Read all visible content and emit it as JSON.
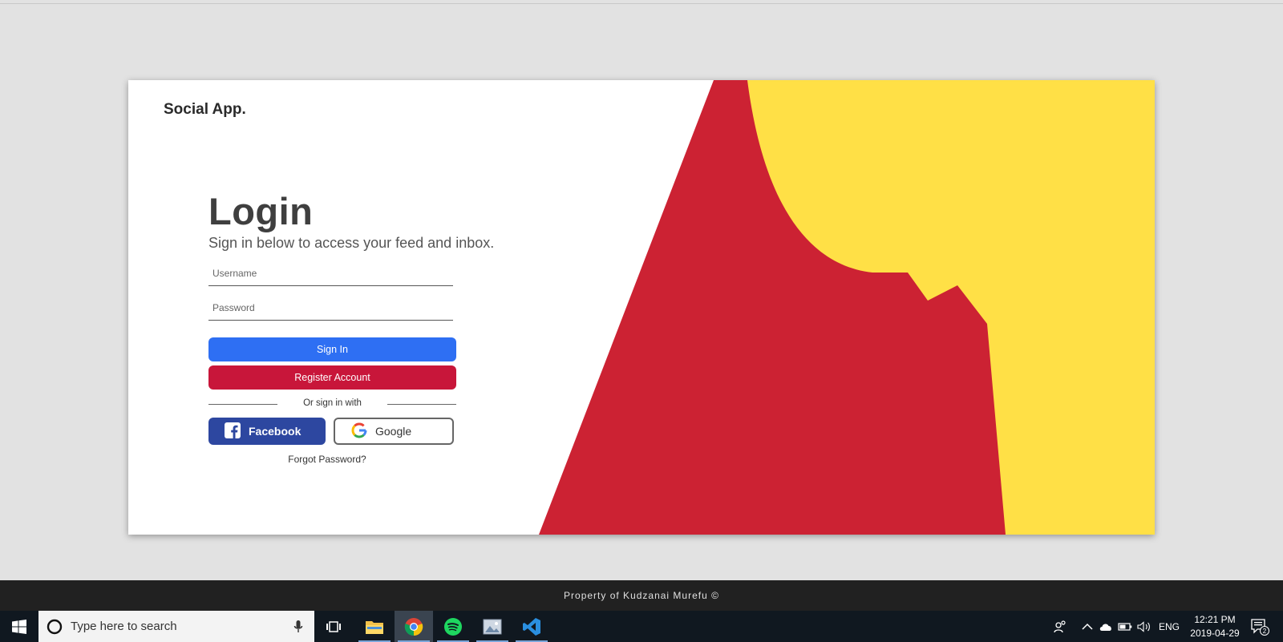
{
  "brand": "Social App.",
  "login": {
    "title": "Login",
    "subtitle": "Sign in below to access your feed and inbox.",
    "username_placeholder": "Username",
    "password_placeholder": "Password",
    "signin_label": "Sign In",
    "register_label": "Register Account",
    "divider_label": "Or sign in with",
    "facebook_label": "Facebook",
    "google_label": "Google",
    "forgot_label": "Forgot Password?"
  },
  "footer": {
    "text": "Property of Kudzanai Murefu ©"
  },
  "taskbar": {
    "search_placeholder": "Type here to search",
    "apps": [
      "file-explorer",
      "chrome",
      "spotify",
      "photos",
      "vscode"
    ],
    "lang": "ENG",
    "time": "12:21 PM",
    "date": "2019-04-29",
    "notification_count": "2"
  },
  "colors": {
    "accent_blue": "#2e6ff3",
    "accent_red": "#c8163a",
    "facebook": "#2d47a0",
    "art_red": "#cc2233",
    "art_yellow": "#ffe046"
  }
}
